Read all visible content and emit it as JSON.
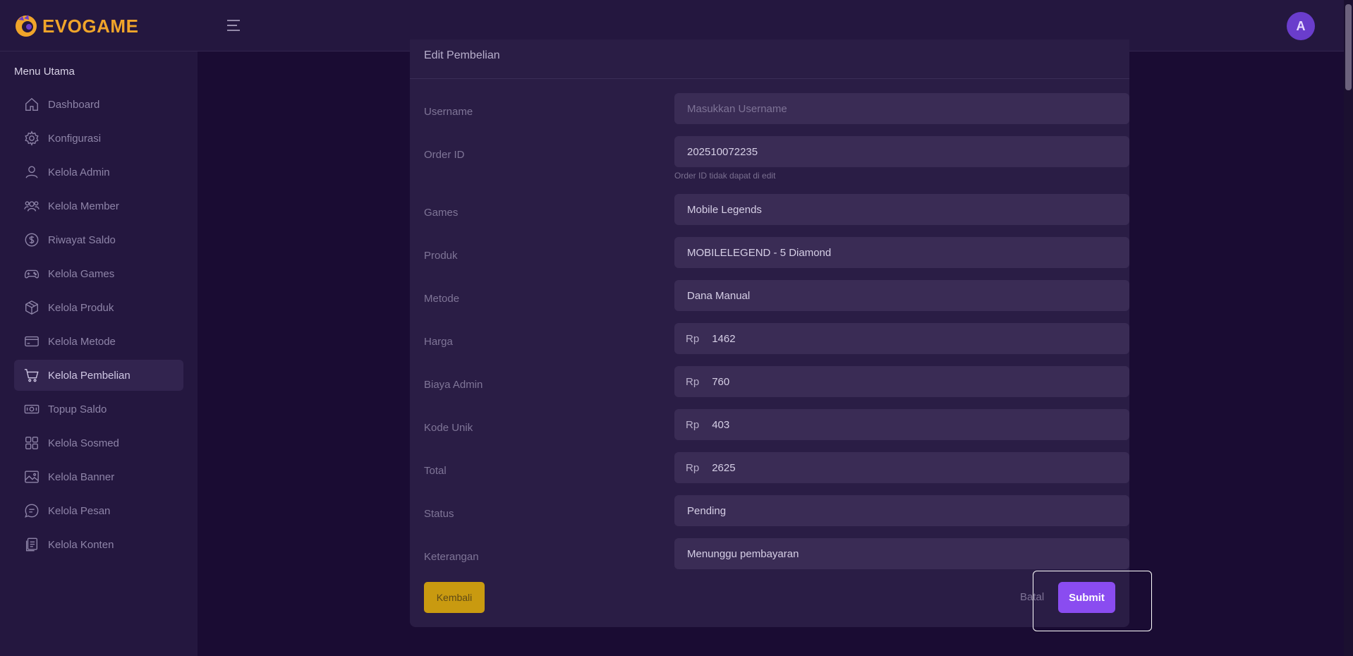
{
  "brand": {
    "name": "EVOGAME",
    "color": "#f0a52a"
  },
  "header": {
    "avatar_initial": "A"
  },
  "sidebar": {
    "title": "Menu Utama",
    "items": [
      {
        "label": "Dashboard",
        "icon": "home-icon"
      },
      {
        "label": "Konfigurasi",
        "icon": "gear-icon"
      },
      {
        "label": "Kelola Admin",
        "icon": "user-icon"
      },
      {
        "label": "Kelola Member",
        "icon": "users-icon"
      },
      {
        "label": "Riwayat Saldo",
        "icon": "dollar-circle-icon"
      },
      {
        "label": "Kelola Games",
        "icon": "gamepad-icon"
      },
      {
        "label": "Kelola Produk",
        "icon": "box-icon"
      },
      {
        "label": "Kelola Metode",
        "icon": "card-icon"
      },
      {
        "label": "Kelola Pembelian",
        "icon": "cart-icon",
        "active": true
      },
      {
        "label": "Topup Saldo",
        "icon": "money-icon"
      },
      {
        "label": "Kelola Sosmed",
        "icon": "grid-icon"
      },
      {
        "label": "Kelola Banner",
        "icon": "image-icon"
      },
      {
        "label": "Kelola Pesan",
        "icon": "chat-icon"
      },
      {
        "label": "Kelola Konten",
        "icon": "document-icon"
      }
    ]
  },
  "form": {
    "title": "Edit Pembelian",
    "currency_prefix": "Rp",
    "fields": {
      "username": {
        "label": "Username",
        "placeholder": "Masukkan Username",
        "value": ""
      },
      "order_id": {
        "label": "Order ID",
        "value": "202510072235",
        "hint": "Order ID tidak dapat di edit"
      },
      "games": {
        "label": "Games",
        "value": "Mobile Legends"
      },
      "produk": {
        "label": "Produk",
        "value": "MOBILELEGEND - 5 Diamond"
      },
      "metode": {
        "label": "Metode",
        "value": "Dana Manual"
      },
      "harga": {
        "label": "Harga",
        "value": "1462"
      },
      "biaya_admin": {
        "label": "Biaya Admin",
        "value": "760"
      },
      "kode_unik": {
        "label": "Kode Unik",
        "value": "403"
      },
      "total": {
        "label": "Total",
        "value": "2625"
      },
      "status": {
        "label": "Status",
        "value": "Pending"
      },
      "keterangan": {
        "label": "Keterangan",
        "value": "Menunggu pembayaran"
      }
    },
    "buttons": {
      "back": "Kembali",
      "cancel": "Batal",
      "submit": "Submit"
    }
  },
  "colors": {
    "background": "#1a0c33",
    "panel": "#24173f",
    "card": "#2a1d45",
    "field": "#3a2c55",
    "accent_purple": "#8a4cf0",
    "accent_yellow": "#c99a10"
  }
}
